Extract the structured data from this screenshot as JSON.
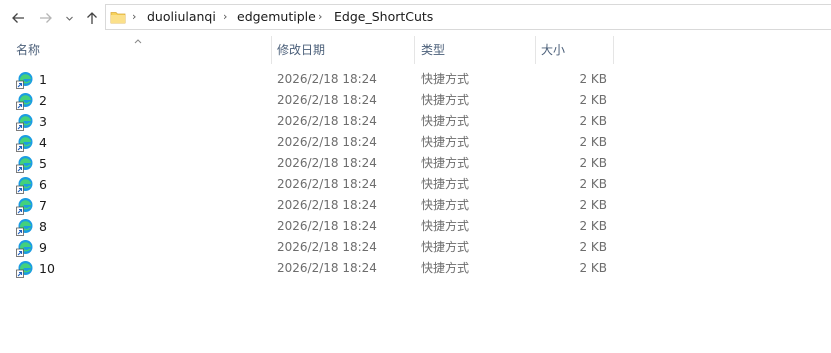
{
  "breadcrumb": [
    "duoliulanqi",
    "edgemutiple",
    "Edge_ShortCuts"
  ],
  "columns": {
    "name": "名称",
    "date": "修改日期",
    "type": "类型",
    "size": "大小"
  },
  "files": [
    {
      "name": "1",
      "date": "2026/2/18 18:24",
      "type": "快捷方式",
      "size": "2 KB"
    },
    {
      "name": "2",
      "date": "2026/2/18 18:24",
      "type": "快捷方式",
      "size": "2 KB"
    },
    {
      "name": "3",
      "date": "2026/2/18 18:24",
      "type": "快捷方式",
      "size": "2 KB"
    },
    {
      "name": "4",
      "date": "2026/2/18 18:24",
      "type": "快捷方式",
      "size": "2 KB"
    },
    {
      "name": "5",
      "date": "2026/2/18 18:24",
      "type": "快捷方式",
      "size": "2 KB"
    },
    {
      "name": "6",
      "date": "2026/2/18 18:24",
      "type": "快捷方式",
      "size": "2 KB"
    },
    {
      "name": "7",
      "date": "2026/2/18 18:24",
      "type": "快捷方式",
      "size": "2 KB"
    },
    {
      "name": "8",
      "date": "2026/2/18 18:24",
      "type": "快捷方式",
      "size": "2 KB"
    },
    {
      "name": "9",
      "date": "2026/2/18 18:24",
      "type": "快捷方式",
      "size": "2 KB"
    },
    {
      "name": "10",
      "date": "2026/2/18 18:24",
      "type": "快捷方式",
      "size": "2 KB"
    }
  ],
  "icons": {
    "back": "back-arrow-icon",
    "forward": "forward-arrow-icon",
    "recent": "chevron-down-icon",
    "up": "up-arrow-icon",
    "folder": "folder-icon",
    "file": "edge-shortcut-icon"
  },
  "colors": {
    "header_text": "#4c607a",
    "meta_text": "#6d6d6d",
    "folder": "#f7d25b"
  }
}
